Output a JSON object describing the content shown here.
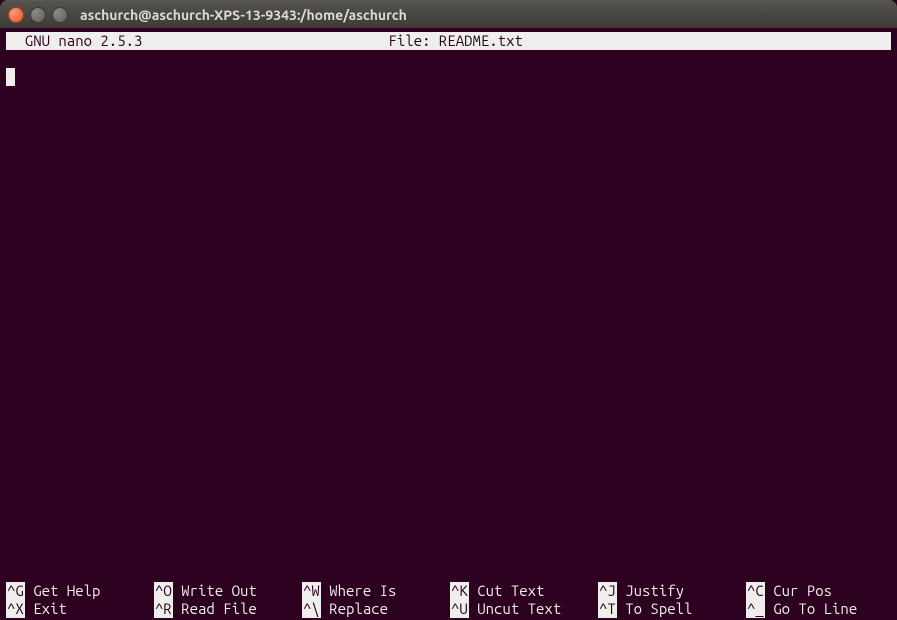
{
  "window": {
    "title": "aschurch@aschurch-XPS-13-9343:/home/aschurch"
  },
  "nano": {
    "version": "  GNU nano 2.5.3",
    "file_label": "File: README.txt"
  },
  "shortcuts": {
    "row1": [
      {
        "key": "^G",
        "label": " Get Help"
      },
      {
        "key": "^O",
        "label": " Write Out"
      },
      {
        "key": "^W",
        "label": " Where Is"
      },
      {
        "key": "^K",
        "label": " Cut Text"
      },
      {
        "key": "^J",
        "label": " Justify"
      },
      {
        "key": "^C",
        "label": " Cur Pos"
      }
    ],
    "row2": [
      {
        "key": "^X",
        "label": " Exit"
      },
      {
        "key": "^R",
        "label": " Read File"
      },
      {
        "key": "^\\",
        "label": " Replace"
      },
      {
        "key": "^U",
        "label": " Uncut Text"
      },
      {
        "key": "^T",
        "label": " To Spell"
      },
      {
        "key": "^_",
        "label": " Go To Line"
      }
    ]
  }
}
